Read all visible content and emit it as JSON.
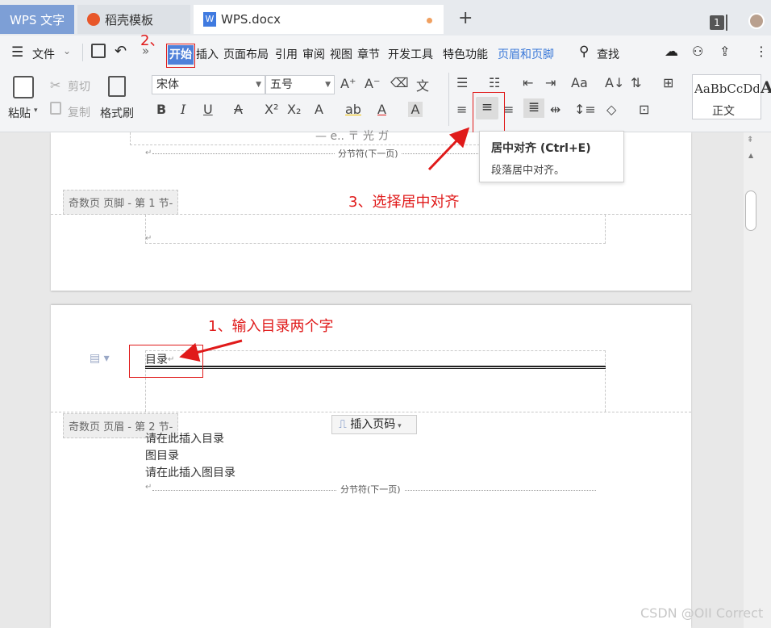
{
  "tabs": {
    "wps": "WPS 文字",
    "daoke": "稻壳模板",
    "doc": "WPS.docx",
    "new_tab": "+",
    "window_count": "1"
  },
  "menu": {
    "file": "文件",
    "start": "开始",
    "insert": "插入",
    "layout": "页面布局",
    "reference": "引用",
    "review": "审阅",
    "view": "视图",
    "chapter": "章节",
    "developer": "开发工具",
    "special": "特色功能",
    "header_footer": "页眉和页脚",
    "search": "查找"
  },
  "ribbon": {
    "paste": "粘贴",
    "cut": "剪切",
    "copy": "复制",
    "format_painter": "格式刷",
    "font_name": "宋体",
    "font_size": "五号",
    "style_preview": "AaBbCcDd",
    "style_name": "正文"
  },
  "tooltip": {
    "title": "居中对齐 (Ctrl+E)",
    "desc": "段落居中对齐。"
  },
  "document": {
    "page1_top_text": "— e.. 〒 光 ガ",
    "section_break": "分节符(下一页)",
    "odd_footer_label": "奇数页 页脚  - 第 1 节-",
    "odd_header_label": "奇数页 页眉  - 第 2 节-",
    "heading_text": "目录",
    "insert_page_number": "插入页码",
    "line1": "请在此插入目录",
    "line2": "图目录",
    "line3": "请在此插入图目录"
  },
  "annotations": {
    "step1": "1、输入目录两个字",
    "step2": "2、",
    "step3": "3、选择居中对齐"
  },
  "watermark": "CSDN @OII Correct",
  "colors": {
    "annotation_red": "#e01a1a",
    "active_tab_blue": "#4f80d9",
    "header_footer_blue": "#3a78d8"
  }
}
